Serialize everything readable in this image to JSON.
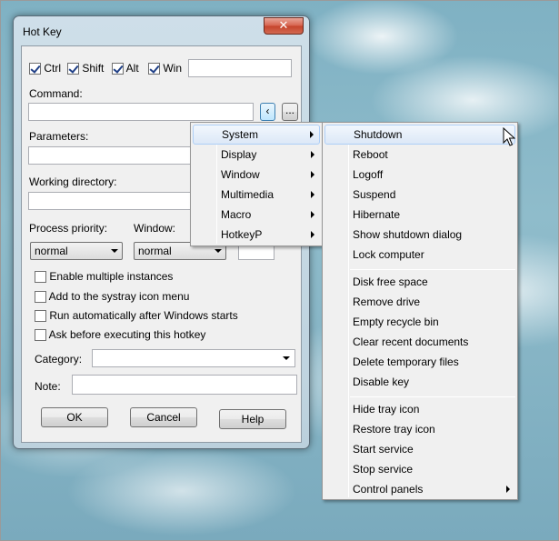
{
  "window": {
    "title": "Hot Key"
  },
  "modifiers": [
    {
      "label": "Ctrl",
      "checked": true
    },
    {
      "label": "Shift",
      "checked": true
    },
    {
      "label": "Alt",
      "checked": true
    },
    {
      "label": "Win",
      "checked": true
    }
  ],
  "hotkey_value": "",
  "command": {
    "label": "Command:",
    "value": "",
    "menu_button": "‹",
    "browse_button": "..."
  },
  "parameters": {
    "label": "Parameters:",
    "value": ""
  },
  "working_directory": {
    "label": "Working directory:",
    "value": ""
  },
  "process_priority": {
    "label": "Process priority:",
    "value": "normal"
  },
  "window_mode": {
    "label": "Window:",
    "value": "normal"
  },
  "options": [
    {
      "label": "Enable multiple instances",
      "checked": false
    },
    {
      "label": "Add to the systray icon menu",
      "checked": false
    },
    {
      "label": "Run automatically after Windows starts",
      "checked": false
    },
    {
      "label": "Ask before executing this hotkey",
      "checked": false
    }
  ],
  "category": {
    "label": "Category:",
    "value": ""
  },
  "note": {
    "label": "Note:",
    "value": ""
  },
  "buttons": {
    "ok": "OK",
    "cancel": "Cancel",
    "help": "Help"
  },
  "menu1": {
    "items": [
      {
        "label": "System",
        "submenu": true,
        "highlighted": true
      },
      {
        "label": "Display",
        "submenu": true
      },
      {
        "label": "Window",
        "submenu": true
      },
      {
        "label": "Multimedia",
        "submenu": true
      },
      {
        "label": "Macro",
        "submenu": true
      },
      {
        "label": "HotkeyP",
        "submenu": true
      }
    ]
  },
  "menu2": {
    "groups": [
      [
        "Shutdown",
        "Reboot",
        "Logoff",
        "Suspend",
        "Hibernate",
        "Show shutdown dialog",
        "Lock computer"
      ],
      [
        "Disk free space",
        "Remove drive",
        "Empty recycle bin",
        "Clear recent documents",
        "Delete temporary files",
        "Disable key"
      ],
      [
        "Hide tray icon",
        "Restore tray icon",
        "Start service",
        "Stop service",
        "Control panels"
      ]
    ],
    "highlighted": "Shutdown",
    "submenu_items": [
      "Control panels"
    ]
  },
  "colors": {
    "highlight_border": "#aecff7",
    "close_red": "#c5432b",
    "menu_bg": "#f0f0f0"
  }
}
